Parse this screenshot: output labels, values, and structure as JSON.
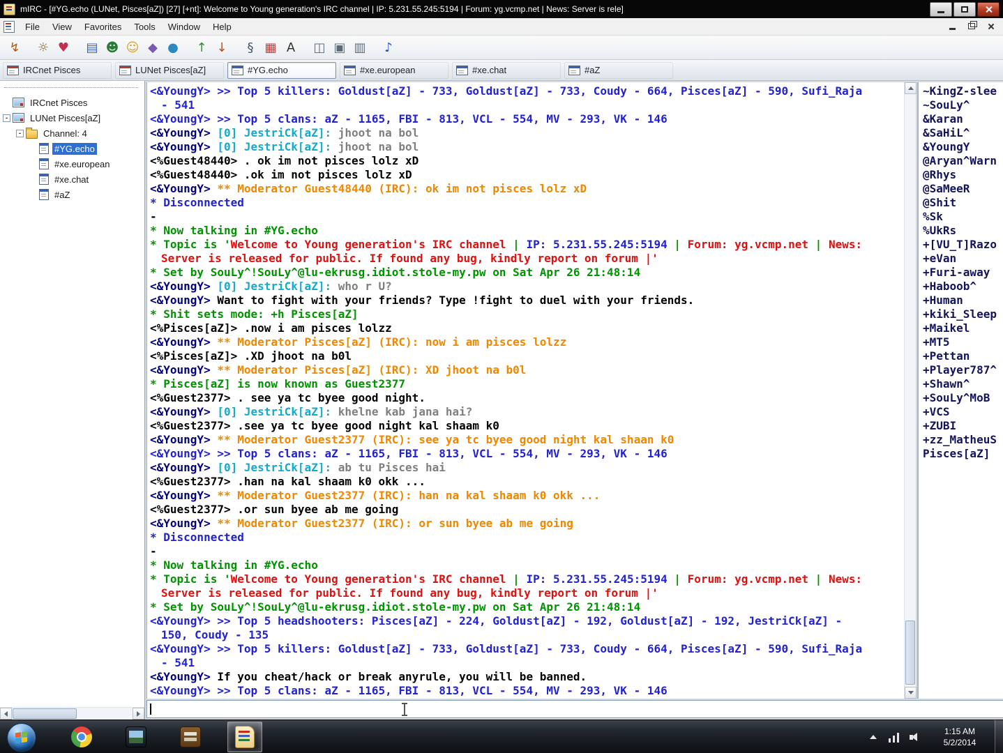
{
  "window": {
    "title": "mIRC - [#YG.echo (LUNet, Pisces[aZ]) [27] [+nt]: Welcome to Young generation's IRC channel | IP: 5.231.55.245:5194 | Forum: yg.vcmp.net | News: Server is rele]"
  },
  "menu": {
    "items": [
      "File",
      "View",
      "Favorites",
      "Tools",
      "Window",
      "Help"
    ]
  },
  "toolbar": {
    "icons": [
      {
        "name": "connect",
        "glyph": "↯",
        "color": "#b05a10"
      },
      {
        "name": "options",
        "glyph": "☼",
        "color": "#8a6a10",
        "gap": true
      },
      {
        "name": "favorites",
        "glyph": "♥",
        "color": "#c23050"
      },
      {
        "name": "channels-list",
        "glyph": "▤",
        "color": "#3a62b8",
        "gap": true
      },
      {
        "name": "query",
        "glyph": "☻",
        "color": "#2a7a3a"
      },
      {
        "name": "address-book",
        "glyph": "☺",
        "color": "#d79b22"
      },
      {
        "name": "url-list",
        "glyph": "◆",
        "color": "#7a5ab0"
      },
      {
        "name": "notify-list",
        "glyph": "●",
        "color": "#2a8ac0"
      },
      {
        "name": "dcc-send",
        "glyph": "↑",
        "color": "#2f8f2f",
        "gap": true
      },
      {
        "name": "dcc-get",
        "glyph": "↓",
        "color": "#b05030"
      },
      {
        "name": "scripts-editor",
        "glyph": "§",
        "color": "#405060",
        "gap": true
      },
      {
        "name": "colors",
        "glyph": "▦",
        "color": "#c04040"
      },
      {
        "name": "fonts",
        "glyph": "A",
        "color": "#303030"
      },
      {
        "name": "tile-windows",
        "glyph": "◫",
        "color": "#5a6a7a",
        "gap": true
      },
      {
        "name": "cascade-windows",
        "glyph": "▣",
        "color": "#5a6a7a"
      },
      {
        "name": "switchbar-toggle",
        "glyph": "▥",
        "color": "#5a6a7a"
      },
      {
        "name": "help",
        "glyph": "♪",
        "color": "#2255cc",
        "gap": true
      }
    ]
  },
  "switchbar": {
    "tabs": [
      {
        "label": "IRCnet Pisces",
        "kind": "status",
        "active": false
      },
      {
        "label": "LUNet Pisces[aZ]",
        "kind": "status",
        "active": false
      },
      {
        "label": "#YG.echo",
        "kind": "channel",
        "active": true
      },
      {
        "label": "#xe.european",
        "kind": "channel",
        "active": false
      },
      {
        "label": "#xe.chat",
        "kind": "channel",
        "active": false
      },
      {
        "label": "#aZ",
        "kind": "channel",
        "active": false
      }
    ]
  },
  "tree": {
    "items": [
      {
        "label": "IRCnet Pisces",
        "icon": "status",
        "level": 0,
        "expand": null,
        "selected": false
      },
      {
        "label": "LUNet Pisces[aZ]",
        "icon": "status",
        "level": 0,
        "expand": "minus",
        "selected": false
      },
      {
        "label": "Channel: 4",
        "icon": "folder",
        "level": 1,
        "expand": "minus",
        "selected": false
      },
      {
        "label": "#YG.echo",
        "icon": "channel",
        "level": 2,
        "expand": null,
        "selected": true
      },
      {
        "label": "#xe.european",
        "icon": "channel",
        "level": 2,
        "expand": null,
        "selected": false
      },
      {
        "label": "#xe.chat",
        "icon": "channel",
        "level": 2,
        "expand": null,
        "selected": false
      },
      {
        "label": "#aZ",
        "icon": "channel",
        "level": 2,
        "expand": null,
        "selected": false
      }
    ]
  },
  "chat": {
    "lines": [
      {
        "seg": [
          [
            "blue",
            "<&YoungY> >> Top 5 killers: Goldust[aZ] - 733, Goldust[aZ] - 733, Coudy - 664, Pisces[aZ] - 590, Sufi_Raja"
          ]
        ]
      },
      {
        "cont": true,
        "seg": [
          [
            "blue",
            "- 541"
          ]
        ]
      },
      {
        "seg": [
          [
            "blue",
            "<&YoungY> >> Top 5 clans: aZ - 1165, FBI - 813, VCL - 554, MV - 293, VK - 146"
          ]
        ]
      },
      {
        "seg": [
          [
            "navy",
            "<&YoungY> "
          ],
          [
            "cyan",
            "[0] JestriCk[aZ]:"
          ],
          [
            "gray",
            " jhoot na bol"
          ]
        ]
      },
      {
        "seg": [
          [
            "navy",
            "<&YoungY> "
          ],
          [
            "cyan",
            "[0] JestriCk[aZ]:"
          ],
          [
            "gray",
            " jhoot na bol"
          ]
        ]
      },
      {
        "seg": [
          [
            "black",
            "<%Guest48440> . ok im not pisces lolz xD"
          ]
        ]
      },
      {
        "seg": [
          [
            "black",
            "<%Guest48440> .ok im not pisces lolz xD"
          ]
        ]
      },
      {
        "seg": [
          [
            "navy",
            "<&YoungY> "
          ],
          [
            "orange",
            "** Moderator Guest48440 (IRC): ok im not pisces lolz xD"
          ]
        ]
      },
      {
        "seg": [
          [
            "blue",
            "* Disconnected"
          ]
        ]
      },
      {
        "seg": [
          [
            "black",
            "-"
          ]
        ]
      },
      {
        "seg": [
          [
            "green",
            "* Now talking in #YG.echo"
          ]
        ]
      },
      {
        "seg": [
          [
            "green",
            "* Topic is '"
          ],
          [
            "red",
            "Welcome to Young generation's IRC channel"
          ],
          [
            "green",
            " | "
          ],
          [
            "blue",
            "IP: 5.231.55.245:5194"
          ],
          [
            "green",
            " | "
          ],
          [
            "red",
            "Forum: yg.vcmp.net"
          ],
          [
            "green",
            " | "
          ],
          [
            "red",
            "News:"
          ]
        ]
      },
      {
        "cont": true,
        "seg": [
          [
            "red",
            "Server is released for public. If found any bug, kindly report on forum |'"
          ]
        ]
      },
      {
        "seg": [
          [
            "green",
            "* Set by SouLy^!SouLy^@lu-ekrusg.idiot.stole-my.pw on Sat Apr 26 21:48:14"
          ]
        ]
      },
      {
        "seg": [
          [
            "navy",
            "<&YoungY> "
          ],
          [
            "cyan",
            "[0] JestriCk[aZ]:"
          ],
          [
            "gray",
            " who r U?"
          ]
        ]
      },
      {
        "seg": [
          [
            "navy",
            "<&YoungY> "
          ],
          [
            "black",
            "Want to fight with your friends? Type !fight to duel with your friends."
          ]
        ]
      },
      {
        "seg": [
          [
            "green",
            "* Shit sets mode: +h Pisces[aZ]"
          ]
        ]
      },
      {
        "seg": [
          [
            "black",
            "<%Pisces[aZ]> .now i am pisces lolzz"
          ]
        ]
      },
      {
        "seg": [
          [
            "navy",
            "<&YoungY> "
          ],
          [
            "orange",
            "** Moderator Pisces[aZ] (IRC): now i am pisces lolzz"
          ]
        ]
      },
      {
        "seg": [
          [
            "black",
            "<%Pisces[aZ]> .XD jhoot na b0l"
          ]
        ]
      },
      {
        "seg": [
          [
            "navy",
            "<&YoungY> "
          ],
          [
            "orange",
            "** Moderator Pisces[aZ] (IRC): XD jhoot na b0l"
          ]
        ]
      },
      {
        "seg": [
          [
            "green",
            "* Pisces[aZ] is now known as Guest2377"
          ]
        ]
      },
      {
        "seg": [
          [
            "black",
            "<%Guest2377> . see ya tc byee good night."
          ]
        ]
      },
      {
        "seg": [
          [
            "navy",
            "<&YoungY> "
          ],
          [
            "cyan",
            "[0] JestriCk[aZ]:"
          ],
          [
            "gray",
            " khelne kab jana hai?"
          ]
        ]
      },
      {
        "seg": [
          [
            "black",
            "<%Guest2377> .see ya tc byee good night kal shaam k0"
          ]
        ]
      },
      {
        "seg": [
          [
            "navy",
            "<&YoungY> "
          ],
          [
            "orange",
            "** Moderator Guest2377 (IRC): see ya tc byee good night kal shaan k0"
          ]
        ]
      },
      {
        "seg": [
          [
            "blue",
            "<&YoungY> >> Top 5 clans: aZ - 1165, FBI - 813, VCL - 554, MV - 293, VK - 146"
          ]
        ]
      },
      {
        "seg": [
          [
            "navy",
            "<&YoungY> "
          ],
          [
            "cyan",
            "[0] JestriCk[aZ]:"
          ],
          [
            "gray",
            " ab tu Pisces hai"
          ]
        ]
      },
      {
        "seg": [
          [
            "black",
            "<%Guest2377> .han na kal shaam k0 okk ..."
          ]
        ]
      },
      {
        "seg": [
          [
            "navy",
            "<&YoungY> "
          ],
          [
            "orange",
            "** Moderator Guest2377 (IRC): han na kal shaam k0 okk ..."
          ]
        ]
      },
      {
        "seg": [
          [
            "black",
            "<%Guest2377> .or sun byee ab me going"
          ]
        ]
      },
      {
        "seg": [
          [
            "navy",
            "<&YoungY> "
          ],
          [
            "orange",
            "** Moderator Guest2377 (IRC): or sun byee ab me going"
          ]
        ]
      },
      {
        "seg": [
          [
            "blue",
            "* Disconnected"
          ]
        ]
      },
      {
        "seg": [
          [
            "black",
            "-"
          ]
        ]
      },
      {
        "seg": [
          [
            "green",
            "* Now talking in #YG.echo"
          ]
        ]
      },
      {
        "seg": [
          [
            "green",
            "* Topic is '"
          ],
          [
            "red",
            "Welcome to Young generation's IRC channel"
          ],
          [
            "green",
            " | "
          ],
          [
            "blue",
            "IP: 5.231.55.245:5194"
          ],
          [
            "green",
            " | "
          ],
          [
            "red",
            "Forum: yg.vcmp.net"
          ],
          [
            "green",
            " | "
          ],
          [
            "red",
            "News:"
          ]
        ]
      },
      {
        "cont": true,
        "seg": [
          [
            "red",
            "Server is released for public. If found any bug, kindly report on forum |'"
          ]
        ]
      },
      {
        "seg": [
          [
            "green",
            "* Set by SouLy^!SouLy^@lu-ekrusg.idiot.stole-my.pw on Sat Apr 26 21:48:14"
          ]
        ]
      },
      {
        "seg": [
          [
            "blue",
            "<&YoungY> >> Top 5 headshooters: Pisces[aZ] - 224, Goldust[aZ] - 192, Goldust[aZ] - 192, JestriCk[aZ] -"
          ]
        ]
      },
      {
        "cont": true,
        "seg": [
          [
            "blue",
            "150, Coudy - 135"
          ]
        ]
      },
      {
        "seg": [
          [
            "blue",
            "<&YoungY> >> Top 5 killers: Goldust[aZ] - 733, Goldust[aZ] - 733, Coudy - 664, Pisces[aZ] - 590, Sufi_Raja"
          ]
        ]
      },
      {
        "cont": true,
        "seg": [
          [
            "blue",
            "- 541"
          ]
        ]
      },
      {
        "seg": [
          [
            "navy",
            "<&YoungY> "
          ],
          [
            "black",
            "If you cheat/hack or break anyrule, you will be banned."
          ]
        ]
      },
      {
        "seg": [
          [
            "blue",
            "<&YoungY> >> Top 5 clans: aZ - 1165, FBI - 813, VCL - 554, MV - 293, VK - 146"
          ]
        ]
      }
    ]
  },
  "nicklist": {
    "nicks": [
      "~KingZ-slee",
      "~SouLy^",
      "&Karan",
      "&SaHiL^",
      "&YoungY",
      "@Aryan^Warn",
      "@Rhys",
      "@SaMeeR",
      "@Shit",
      "%Sk",
      "%UkRs",
      "+[VU_T]Razo",
      "+eVan",
      "+Furi-away",
      "+Haboob^",
      "+Human",
      "+kiki_Sleep",
      "+Maikel",
      "+MT5",
      "+Pettan",
      "+Player787^",
      "+Shawn^",
      "+SouLy^MoB",
      "+VCS",
      "+ZUBI",
      "+zz_MatheuS",
      "Pisces[aZ]"
    ]
  },
  "input": {
    "value": ""
  },
  "taskbar": {
    "apps": [
      {
        "name": "chrome",
        "active": false
      },
      {
        "name": "image-app",
        "active": false
      },
      {
        "name": "book-app",
        "active": false
      },
      {
        "name": "mirc",
        "active": true
      }
    ],
    "tray": {
      "icons": [
        "hidden-icons",
        "network",
        "volume"
      ],
      "time": "1:15 AM",
      "date": "5/2/2014"
    }
  },
  "colors": {
    "blue": "#2222d2",
    "navy": "#00007f",
    "green": "#009300",
    "red": "#e01010",
    "orange": "#ef8800",
    "cyan": "#12aacd",
    "gray": "#7f7f7f",
    "black": "#000000",
    "nicklist": "#14145e",
    "selection": "#2f6fd0"
  }
}
